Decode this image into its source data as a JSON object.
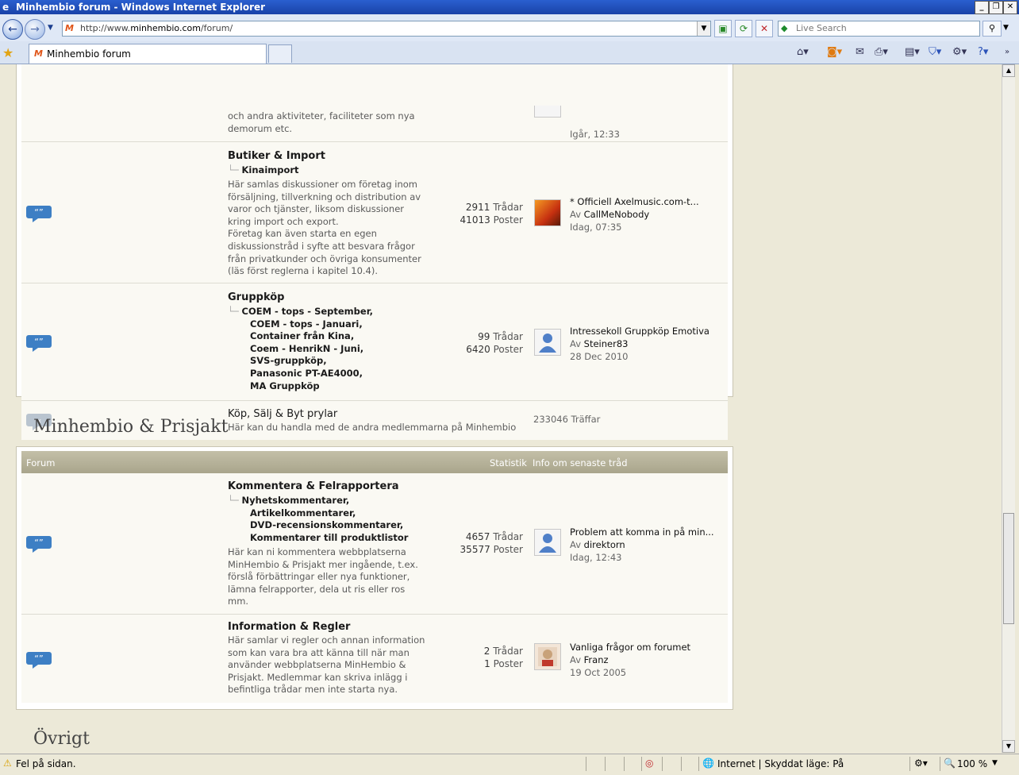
{
  "window": {
    "title": "Minhembio forum - Windows Internet Explorer"
  },
  "toolbar": {
    "url_prefix": "http://www.",
    "url_domain": "minhembio.com",
    "url_path": "/forum/",
    "search_placeholder": "Live Search"
  },
  "tabs": [
    {
      "label": "Minhembio forum"
    }
  ],
  "forum_rows_top": [
    {
      "desc_tail": [
        "och andra aktiviteter, faciliteter som nya",
        "demorum etc."
      ],
      "last_date": "Igår, 12:33"
    },
    {
      "title": "Butiker & Import",
      "subforums": [
        "Kinaimport"
      ],
      "description": [
        "Här samlas diskussioner om företag inom",
        "försäljning, tillverkning och distribution av",
        "varor och tjänster, liksom diskussioner",
        "kring import och export.",
        "Företag kan även starta en egen",
        "diskussionstråd i syfte att besvara frågor",
        "från privatkunder och övriga konsumenter",
        "(läs först reglerna i kapitel 10.4)."
      ],
      "threads": "2911",
      "posts": "41013",
      "last_title": "* Officiell Axelmusic.com-t...",
      "last_by": "CallMeNobody",
      "last_date": "Idag, 07:35"
    },
    {
      "title": "Gruppköp",
      "subforums": [
        "COEM - tops - September,",
        "COEM - tops - Januari,",
        "Container från Kina,",
        "Coem - HenrikN - Juni,",
        "SVS-gruppköp,",
        "Panasonic PT-AE4000,",
        "MA Gruppköp"
      ],
      "threads": "99",
      "posts": "6420",
      "last_title": "Intressekoll Gruppköp Emotiva",
      "last_by": "Steiner83",
      "last_date": "28 Dec 2010"
    },
    {
      "title": "Köp, Sälj & Byt prylar",
      "description": [
        "Här kan du handla med de andra medlemmarna på Minhembio"
      ],
      "hits": "233046 Träffar"
    }
  ],
  "labels": {
    "threads": "Trådar",
    "posts": "Poster",
    "by": "Av",
    "col_forum": "Forum",
    "col_stats": "Statistik",
    "col_last": "Info om senaste tråd"
  },
  "section2": {
    "title": "Minhembio & Prisjakt",
    "rows": [
      {
        "title": "Kommentera & Felrapportera",
        "subforums": [
          "Nyhetskommentarer,",
          "Artikelkommentarer,",
          "DVD-recensionskommentarer,",
          "Kommentarer till produktlistor"
        ],
        "description": [
          "Här kan ni kommentera webbplatserna",
          "MinHembio & Prisjakt mer ingående, t.ex.",
          "förslå förbättringar eller nya funktioner,",
          "lämna felrapporter, dela ut ris eller ros",
          "mm."
        ],
        "threads": "4657",
        "posts": "35577",
        "last_title": "Problem att komma in på min...",
        "last_by": "direktorn",
        "last_date": "Idag, 12:43"
      },
      {
        "title": "Information & Regler",
        "description": [
          "Här samlar vi regler och annan information",
          "som kan vara bra att känna till när man",
          "använder webbplatserna MinHembio &",
          "Prisjakt. Medlemmar kan skriva inlägg i",
          "befintliga trådar men inte starta nya."
        ],
        "threads": "2",
        "posts": "1",
        "last_title": "Vanliga frågor om forumet",
        "last_by": "Franz",
        "last_date": "19 Oct 2005"
      }
    ]
  },
  "section3": {
    "title": "Övrigt"
  },
  "status": {
    "message": "Fel på sidan.",
    "zone": "Internet | Skyddat läge: På",
    "zoom": "100 %"
  },
  "colors": {
    "titlebar": "#1942a8",
    "header_bar": "#a9a58c",
    "bubble": "#3d7fc4"
  }
}
